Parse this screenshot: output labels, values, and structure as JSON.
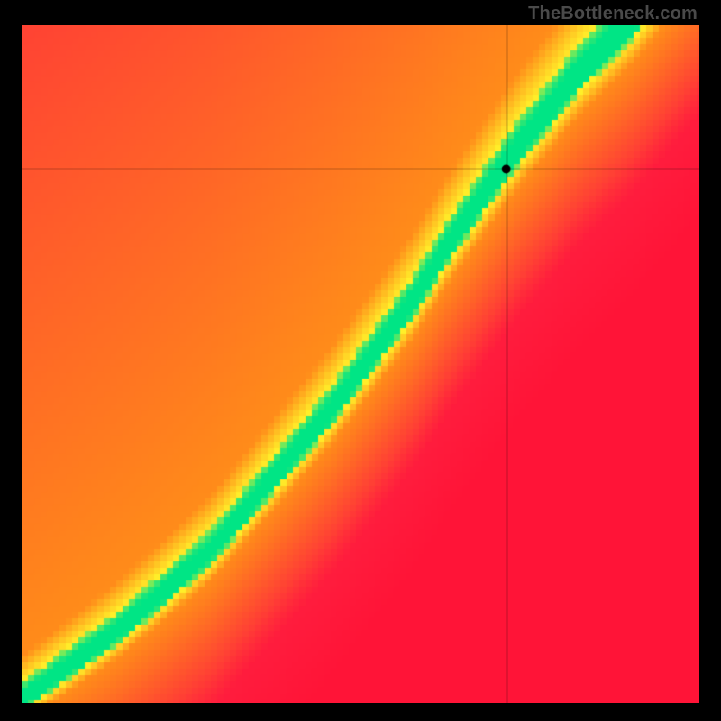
{
  "watermark": "TheBottleneck.com",
  "chart_data": {
    "type": "heatmap",
    "title": "",
    "xlabel": "",
    "ylabel": "",
    "xlim": [
      0,
      1
    ],
    "ylim": [
      0,
      1
    ],
    "pixelation": 7,
    "crosshair": {
      "x": 0.715,
      "y": 0.788
    },
    "ridge": {
      "description": "normalized-y position of green optimal ridge as a function of normalized-x",
      "points": [
        {
          "x": 0.0,
          "y": 0.0
        },
        {
          "x": 0.07,
          "y": 0.05
        },
        {
          "x": 0.14,
          "y": 0.1
        },
        {
          "x": 0.2,
          "y": 0.15
        },
        {
          "x": 0.28,
          "y": 0.22
        },
        {
          "x": 0.34,
          "y": 0.29
        },
        {
          "x": 0.4,
          "y": 0.36
        },
        {
          "x": 0.46,
          "y": 0.43
        },
        {
          "x": 0.52,
          "y": 0.51
        },
        {
          "x": 0.58,
          "y": 0.59
        },
        {
          "x": 0.63,
          "y": 0.67
        },
        {
          "x": 0.68,
          "y": 0.74
        },
        {
          "x": 0.73,
          "y": 0.81
        },
        {
          "x": 0.78,
          "y": 0.87
        },
        {
          "x": 0.82,
          "y": 0.92
        },
        {
          "x": 0.87,
          "y": 0.97
        },
        {
          "x": 0.9,
          "y": 1.0
        }
      ],
      "green_halfwidth_base": 0.024,
      "green_halfwidth_growth": 0.018,
      "yellow_halfwidth_base": 0.055,
      "yellow_halfwidth_growth": 0.055
    },
    "colors": {
      "green": "#00e585",
      "yellow": "#fff02a",
      "orange": "#ff8c1a",
      "red": "#ff2040",
      "crosshair": "#000000",
      "marker": "#000000"
    }
  }
}
